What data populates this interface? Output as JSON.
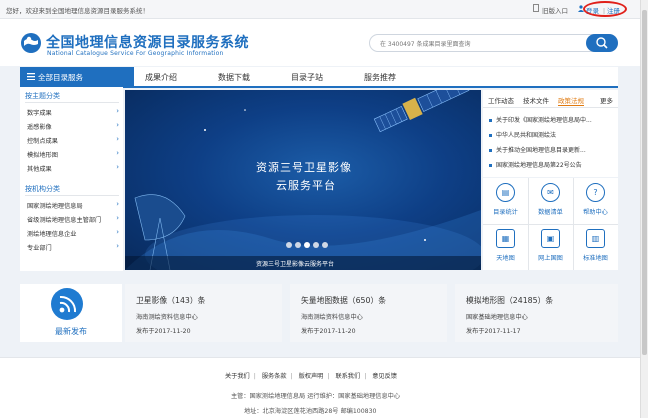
{
  "topbar": {
    "welcome": "您好，欢迎来到全国地理信息资源目录服务系统！",
    "old_entry": "旧版入口",
    "login": "登录",
    "register": "注册"
  },
  "header": {
    "title": "全国地理信息资源目录服务系统",
    "subtitle": "National Catalogue Service For Geographic Information",
    "search_placeholder": "在 3400497 条成果目录里面查询"
  },
  "nav": {
    "home": "全部目录服务",
    "items": [
      "成果介绍",
      "数据下载",
      "目录子站",
      "服务推荐"
    ]
  },
  "sidebar": {
    "by_theme": "按主题分类",
    "theme_items": [
      "数字成果",
      "遥感影像",
      "控制点成果",
      "模拟地形图",
      "其他成果"
    ],
    "by_org": "按机构分类",
    "org_items": [
      "国家测绘地理信息局",
      "省级测绘地理信息主管部门",
      "测绘地理信息企业",
      "专业部门"
    ]
  },
  "banner": {
    "line1": "资源三号卫星影像",
    "line2": "云服务平台",
    "caption": "资源三号卫星影像云服务平台",
    "slides": 5
  },
  "news": {
    "tabs": [
      "工作动态",
      "技术文件",
      "政策法规"
    ],
    "active_tab": "政策法规",
    "more": "更多",
    "items": [
      "关于印发《国家测绘地理信息局中...",
      "中华人民共和国测绘法",
      "关于推动全国地理信息目录更新...",
      "国家测绘地理信息局第22号公告"
    ]
  },
  "quick": [
    {
      "label": "目录统计",
      "icon": "statistics-icon"
    },
    {
      "label": "数据清单",
      "icon": "data-list-icon"
    },
    {
      "label": "帮助中心",
      "icon": "help-icon"
    },
    {
      "label": "天地图",
      "icon": "tianditu-icon"
    },
    {
      "label": "网上国图",
      "icon": "online-map-icon"
    },
    {
      "label": "标准地图",
      "icon": "standard-map-icon"
    }
  ],
  "release": {
    "label": "最新发布"
  },
  "cards": [
    {
      "heading": "卫星影像（143）条",
      "org": "海南测绘资料信息中心",
      "date": "发布于2017-11-20"
    },
    {
      "heading": "矢量地图数据（650）条",
      "org": "海南测绘资料信息中心",
      "date": "发布于2017-11-20"
    },
    {
      "heading": "模拟地形图（24185）条",
      "org": "国家基础地理信息中心",
      "date": "发布于2017-11-17"
    }
  ],
  "footer": {
    "links": [
      "关于我们",
      "服务条款",
      "版权声明",
      "联系我们",
      "意见反馈"
    ],
    "host": "主管：国家测绘地理信息局 运行维护：国家基础地理信息中心",
    "address": "地址：北京海淀区莲花池西路28号 邮编100830"
  },
  "colors": {
    "brand": "#1f6fbf",
    "active_tab": "#e07a10",
    "highlight": "#e0201a"
  }
}
